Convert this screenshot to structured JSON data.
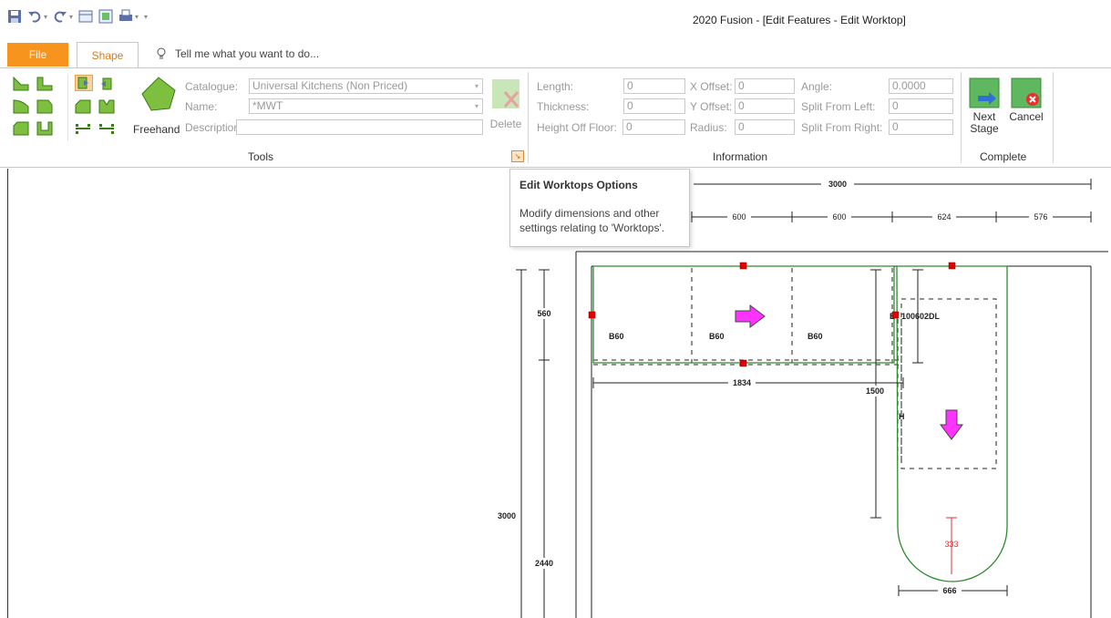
{
  "window": {
    "title": "2020 Fusion - [Edit Features - Edit Worktop]"
  },
  "tabs": {
    "file": "File",
    "shape": "Shape",
    "tell_me": "Tell me what you want to do..."
  },
  "tools": {
    "freehand_label": "Freehand",
    "catalogue_label": "Catalogue:",
    "catalogue_value": "Universal Kitchens (Non Priced)",
    "name_label": "Name:",
    "name_value": "*MWT",
    "description_label": "Description:",
    "description_value": "",
    "delete_label": "Delete",
    "group_label": "Tools"
  },
  "information": {
    "group_label": "Information",
    "length_label": "Length:",
    "length_value": "0",
    "thickness_label": "Thickness:",
    "thickness_value": "0",
    "height_off_floor_label": "Height Off Floor:",
    "height_off_floor_value": "0",
    "x_offset_label": "X Offset:",
    "x_offset_value": "0",
    "y_offset_label": "Y Offset:",
    "y_offset_value": "0",
    "radius_label": "Radius:",
    "radius_value": "0",
    "angle_label": "Angle:",
    "angle_value": "0.0000",
    "split_left_label": "Split From Left:",
    "split_left_value": "0",
    "split_right_label": "Split From Right:",
    "split_right_value": "0"
  },
  "complete": {
    "group_label": "Complete",
    "next_label_1": "Next",
    "next_label_2": "Stage",
    "cancel_label": "Cancel"
  },
  "tooltip": {
    "title": "Edit Worktops Options",
    "body": "Modify dimensions and other settings relating to 'Worktops'."
  },
  "drawing": {
    "dim_total": "3000",
    "dim_seg_1": "600",
    "dim_seg_2": "600",
    "dim_seg_3": "624",
    "dim_seg_4": "576",
    "dim_depth": "560",
    "dim_height_total": "3000",
    "dim_height_lower": "2440",
    "dim_run": "1834",
    "dim_side": "1500",
    "dim_radius": "333",
    "dim_bottom": "666",
    "cab_1": "B60",
    "cab_2": "B60",
    "cab_3": "B60",
    "cab_4_prefix": "B",
    "cab_4": "100602DL",
    "cab_5": "H"
  },
  "colors": {
    "file_tab": "#f7941d",
    "worktop_line": "#2e8b2e",
    "grip": "#e00000",
    "arrow": "#ff00ff",
    "dim_red": "#e03030"
  }
}
